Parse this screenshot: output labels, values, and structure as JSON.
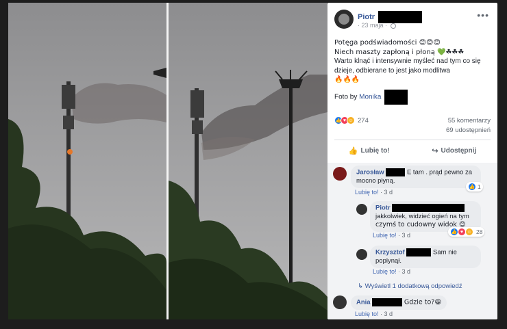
{
  "post": {
    "author": "Piotr",
    "date": "23 maja",
    "more": "•••",
    "text_lines": [
      "Potęga podświadomości 😊😊😊",
      "Niech maszty zapłoną i płoną 💚☘☘☘",
      "Warto klnąć i intensywnie myśleć nad tym co się",
      "dzieje, odbierane to jest jako modlitwa",
      "🔥🔥🔥"
    ],
    "foto_by_label": "Foto by",
    "foto_by_name": "Monika",
    "reaction_count": "274",
    "comments_count": "55 komentarzy",
    "shares_count": "69 udostępnień",
    "like_label": "Lubię to!",
    "share_label": "Udostępnij"
  },
  "comments": [
    {
      "name": "Jarosław",
      "text_1": "E tam . prąd pewno za",
      "text_2": "mocno płyną.",
      "like": "Lubię to!",
      "age": "3 d",
      "reactions": "1"
    },
    {
      "name": "Piotr",
      "text_1": "jakkolwiek, widzieć ogień na tym",
      "text_2": "czymś to cudowny widok 😊",
      "like": "Lubię to!",
      "age": "3 d",
      "reactions": "28"
    },
    {
      "name": "Krzysztof",
      "text_1": "Sam nie",
      "text_2": "poplynął.",
      "like": "Lubię to!",
      "age": "3 d"
    },
    {
      "name": "Ania",
      "text_1": "Gdzie to?😀",
      "like": "Lubię to!",
      "age": "3 d"
    }
  ],
  "more_replies": "Wyświetl 1 dodatkową odpowiedź",
  "icons": [
    "globe-icon",
    "like-icon",
    "share-icon",
    "reply-arrow-icon"
  ],
  "colors": {
    "link": "#385898",
    "panel_bg": "#ffffff",
    "comment_bg": "#e9ebee"
  }
}
